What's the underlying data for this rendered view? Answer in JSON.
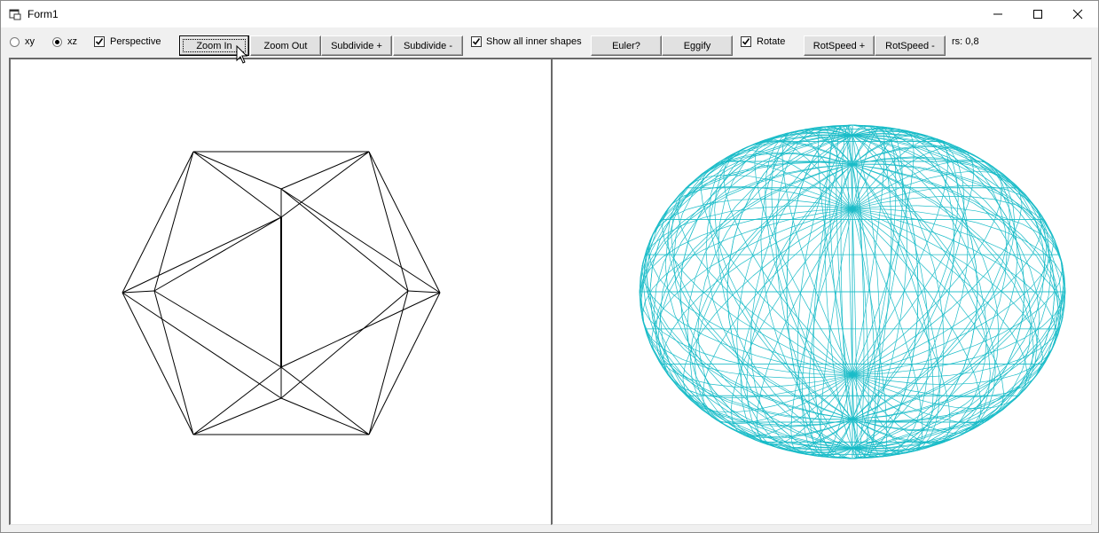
{
  "window": {
    "title": "Form1",
    "controls": {
      "minimize_icon": "minimize-icon",
      "maximize_icon": "maximize-icon",
      "close_icon": "close-icon"
    }
  },
  "toolbar": {
    "radio_xy": {
      "label": "xy",
      "checked": false
    },
    "radio_xz": {
      "label": "xz",
      "checked": true
    },
    "perspective": {
      "label": "Perspective",
      "checked": true
    },
    "zoom_in": "Zoom In",
    "zoom_out": "Zoom Out",
    "subdivide_plus": "Subdivide +",
    "subdivide_minus": "Subdivide -",
    "show_inner": {
      "label": "Show all inner shapes",
      "checked": true
    },
    "euler": "Euler?",
    "eggify": "Eggify",
    "rotate": {
      "label": "Rotate",
      "checked": true
    },
    "rotspeed_plus": "RotSpeed +",
    "rotspeed_minus": "RotSpeed -",
    "rs_readout": "rs: 0,8"
  },
  "colors": {
    "wire_left": "#000000",
    "wire_right": "#1abcc8"
  }
}
